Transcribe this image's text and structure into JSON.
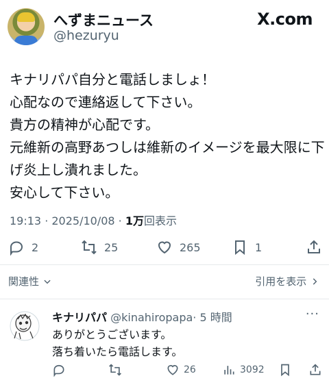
{
  "header": {
    "display_name": "へずまニュース",
    "handle": "@hezuryu",
    "brand": "X.com"
  },
  "tweet": {
    "lines": [
      "キナリパパ自分と電話しましょ！",
      "心配なので連絡返して下さい。",
      "貴方の精神が心配です。",
      "元維新の高野あつしは維新のイメージを最大限に下",
      "げ炎上し潰れました。",
      "安心して下さい。"
    ],
    "time": "19:13 · 2025/10/08 · ",
    "views_count": "1万",
    "views_label": "回表示",
    "replies": "2",
    "retweets": "25",
    "likes": "265",
    "bookmarks": "1"
  },
  "related": {
    "label": "関連性",
    "quote_link": "引用を表示"
  },
  "reply": {
    "name": "キナリパパ",
    "handle": "@kinahiropapa",
    "time": "· 5 時間",
    "more": "···",
    "lines": [
      "ありがとうございます。",
      "落ち着いたら電話します。"
    ],
    "likes": "26",
    "views": "3092"
  },
  "icons": {
    "reply": "reply-icon",
    "retweet": "retweet-icon",
    "like": "heart-icon",
    "bookmark": "bookmark-icon",
    "share": "share-icon",
    "views": "views-icon",
    "chevron": "chevron-down-icon",
    "chevron_right": "chevron-right-icon"
  },
  "colors": {
    "text": "#0f1419",
    "secondary": "#536471",
    "divider": "#e6e9eb"
  }
}
